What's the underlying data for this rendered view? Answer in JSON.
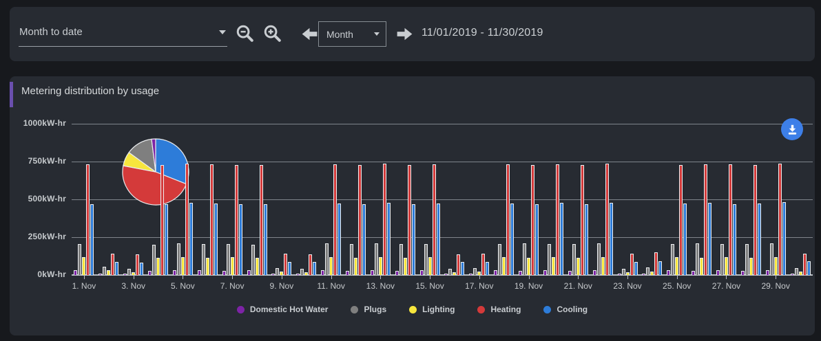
{
  "toolbar": {
    "range_preset": {
      "value": "Month to date"
    },
    "zoom_out_icon": "zoom-out-magnifier",
    "zoom_in_icon": "zoom-in-magnifier",
    "prev_icon": "arrow-left",
    "next_icon": "arrow-right",
    "period_select": {
      "value": "Month"
    },
    "date_range": "11/01/2019 - 11/30/2019"
  },
  "panel": {
    "title": "Metering distribution by usage",
    "accent_color": "#6a4fae",
    "download_icon": "download"
  },
  "chart_data": {
    "type": "bar",
    "title": "Metering distribution by usage",
    "unit": "kW-hr",
    "ylim": [
      0,
      1000
    ],
    "y_tick_labels": [
      "0kW-hr",
      "250kW-hr",
      "500kW-hr",
      "750kW-hr",
      "1000kW-hr"
    ],
    "x_tick_labels": [
      "1. Nov",
      "3. Nov",
      "5. Nov",
      "7. Nov",
      "9. Nov",
      "11. Nov",
      "13. Nov",
      "15. Nov",
      "17. Nov",
      "19. Nov",
      "21. Nov",
      "23. Nov",
      "25. Nov",
      "27. Nov",
      "29. Nov"
    ],
    "days": 30,
    "grid": true,
    "legend_position": "bottom",
    "series": [
      {
        "name": "Domestic Hot Water",
        "color": "#7d23a6",
        "values": [
          30,
          8,
          6,
          28,
          30,
          30,
          28,
          30,
          8,
          6,
          30,
          28,
          30,
          28,
          30,
          5,
          6,
          30,
          28,
          30,
          28,
          30,
          6,
          8,
          30,
          28,
          30,
          28,
          30,
          6
        ]
      },
      {
        "name": "Plugs",
        "color": "#7f7f7f",
        "values": [
          205,
          55,
          40,
          200,
          210,
          205,
          205,
          200,
          45,
          42,
          208,
          205,
          210,
          205,
          205,
          40,
          45,
          205,
          208,
          205,
          205,
          210,
          42,
          48,
          205,
          208,
          205,
          205,
          208,
          45
        ]
      },
      {
        "name": "Lighting",
        "color": "#f7e63d",
        "values": [
          120,
          30,
          20,
          115,
          118,
          115,
          118,
          115,
          22,
          20,
          118,
          115,
          120,
          115,
          118,
          20,
          22,
          118,
          115,
          118,
          115,
          120,
          20,
          22,
          118,
          115,
          118,
          115,
          118,
          22
        ]
      },
      {
        "name": "Heating",
        "color": "#d43a3a",
        "values": [
          730,
          140,
          135,
          725,
          735,
          730,
          728,
          725,
          140,
          138,
          732,
          728,
          735,
          725,
          730,
          138,
          140,
          730,
          728,
          732,
          728,
          735,
          140,
          148,
          728,
          732,
          730,
          725,
          738,
          142
        ]
      },
      {
        "name": "Cooling",
        "color": "#2d7cd9",
        "values": [
          470,
          85,
          80,
          470,
          475,
          472,
          470,
          468,
          88,
          85,
          473,
          470,
          478,
          470,
          472,
          85,
          88,
          473,
          470,
          475,
          470,
          478,
          85,
          90,
          472,
          475,
          470,
          472,
          480,
          90
        ]
      }
    ],
    "pie": {
      "description": "usage share overlay, clockwise from top",
      "slices": [
        {
          "label": "Cooling",
          "percent": 31,
          "color": "#2d7cd9"
        },
        {
          "label": "Heating",
          "percent": 47,
          "color": "#d43a3a"
        },
        {
          "label": "Lighting",
          "percent": 7,
          "color": "#f7e63d"
        },
        {
          "label": "Plugs",
          "percent": 13,
          "color": "#7f7f7f"
        },
        {
          "label": "Domestic Hot Water",
          "percent": 2,
          "color": "#7d23a6"
        }
      ]
    },
    "legend": [
      {
        "label": "Domestic Hot Water",
        "color": "#7d23a6"
      },
      {
        "label": "Plugs",
        "color": "#7f7f7f"
      },
      {
        "label": "Lighting",
        "color": "#f7e63d"
      },
      {
        "label": "Heating",
        "color": "#d43a3a"
      },
      {
        "label": "Cooling",
        "color": "#2d7cd9"
      }
    ]
  }
}
